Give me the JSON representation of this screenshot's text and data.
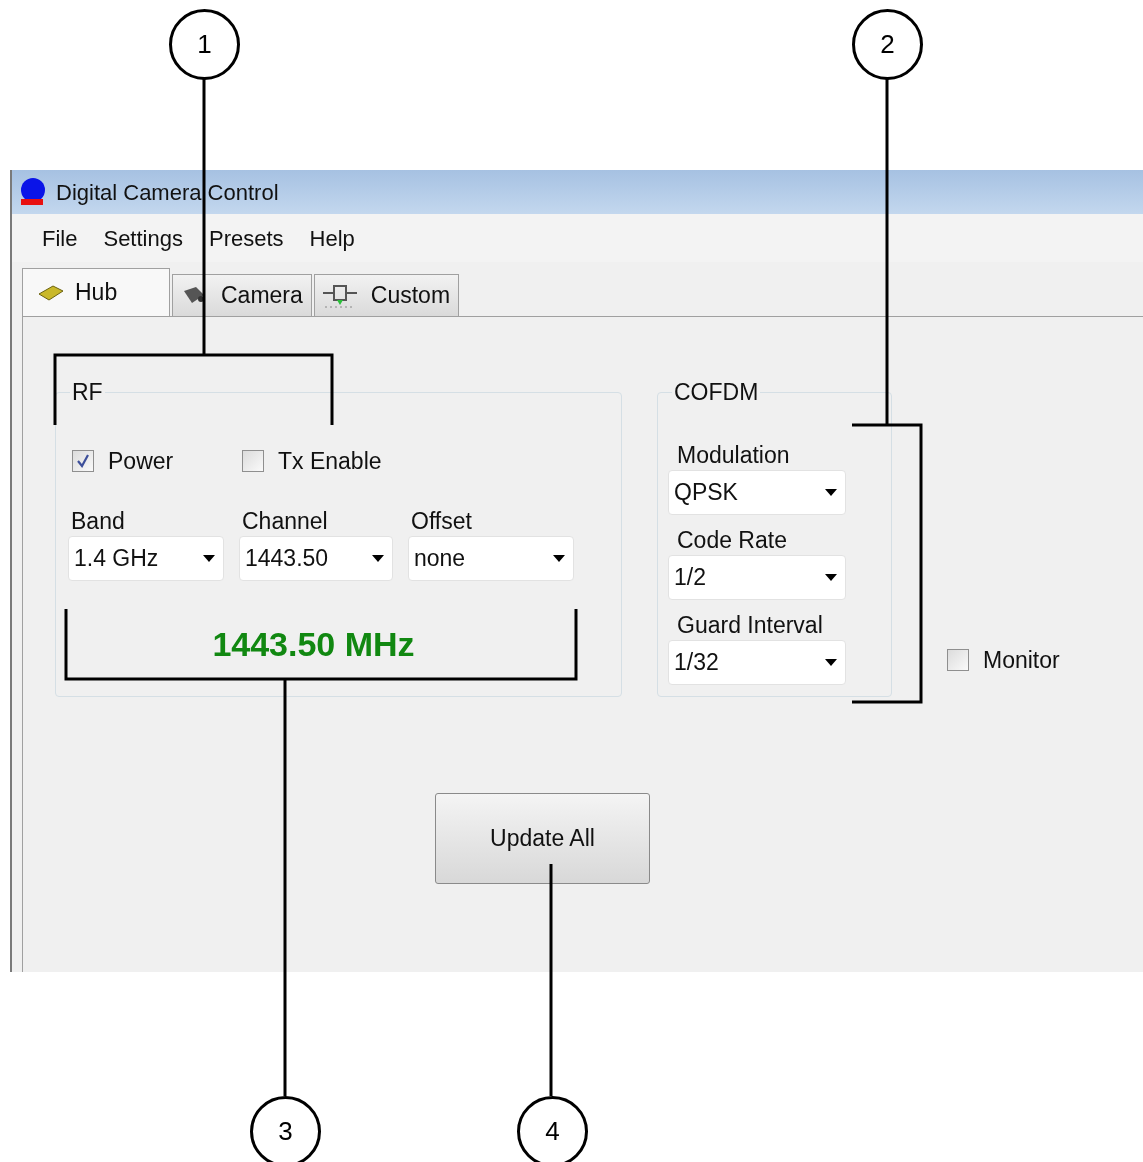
{
  "window": {
    "title": "Digital Camera Control"
  },
  "menu": [
    "File",
    "Settings",
    "Presets",
    "Help"
  ],
  "tabs": [
    {
      "label": "Hub",
      "selected": true,
      "kind": "hub"
    },
    {
      "label": "Camera",
      "selected": false,
      "kind": "camera"
    },
    {
      "label": "Custom",
      "selected": false,
      "kind": "custom"
    }
  ],
  "rf": {
    "title": "RF",
    "checkboxes": [
      {
        "label": "Power",
        "checked": true
      },
      {
        "label": "Tx Enable",
        "checked": false
      }
    ],
    "dropdowns": [
      {
        "label": "Band",
        "value": "1.4 GHz"
      },
      {
        "label": "Channel",
        "value": "1443.50"
      },
      {
        "label": "Offset",
        "value": "none"
      }
    ],
    "frequency": "1443.50 MHz"
  },
  "cofdm": {
    "title": "COFDM",
    "dropdowns": [
      {
        "label": "Modulation",
        "value": "QPSK"
      },
      {
        "label": "Code Rate",
        "value": "1/2"
      },
      {
        "label": "Guard Interval",
        "value": "1/32"
      }
    ]
  },
  "monitor": {
    "label": "Monitor",
    "checked": false
  },
  "update_button": "Update All",
  "callouts": [
    "1",
    "2",
    "3",
    "4"
  ]
}
